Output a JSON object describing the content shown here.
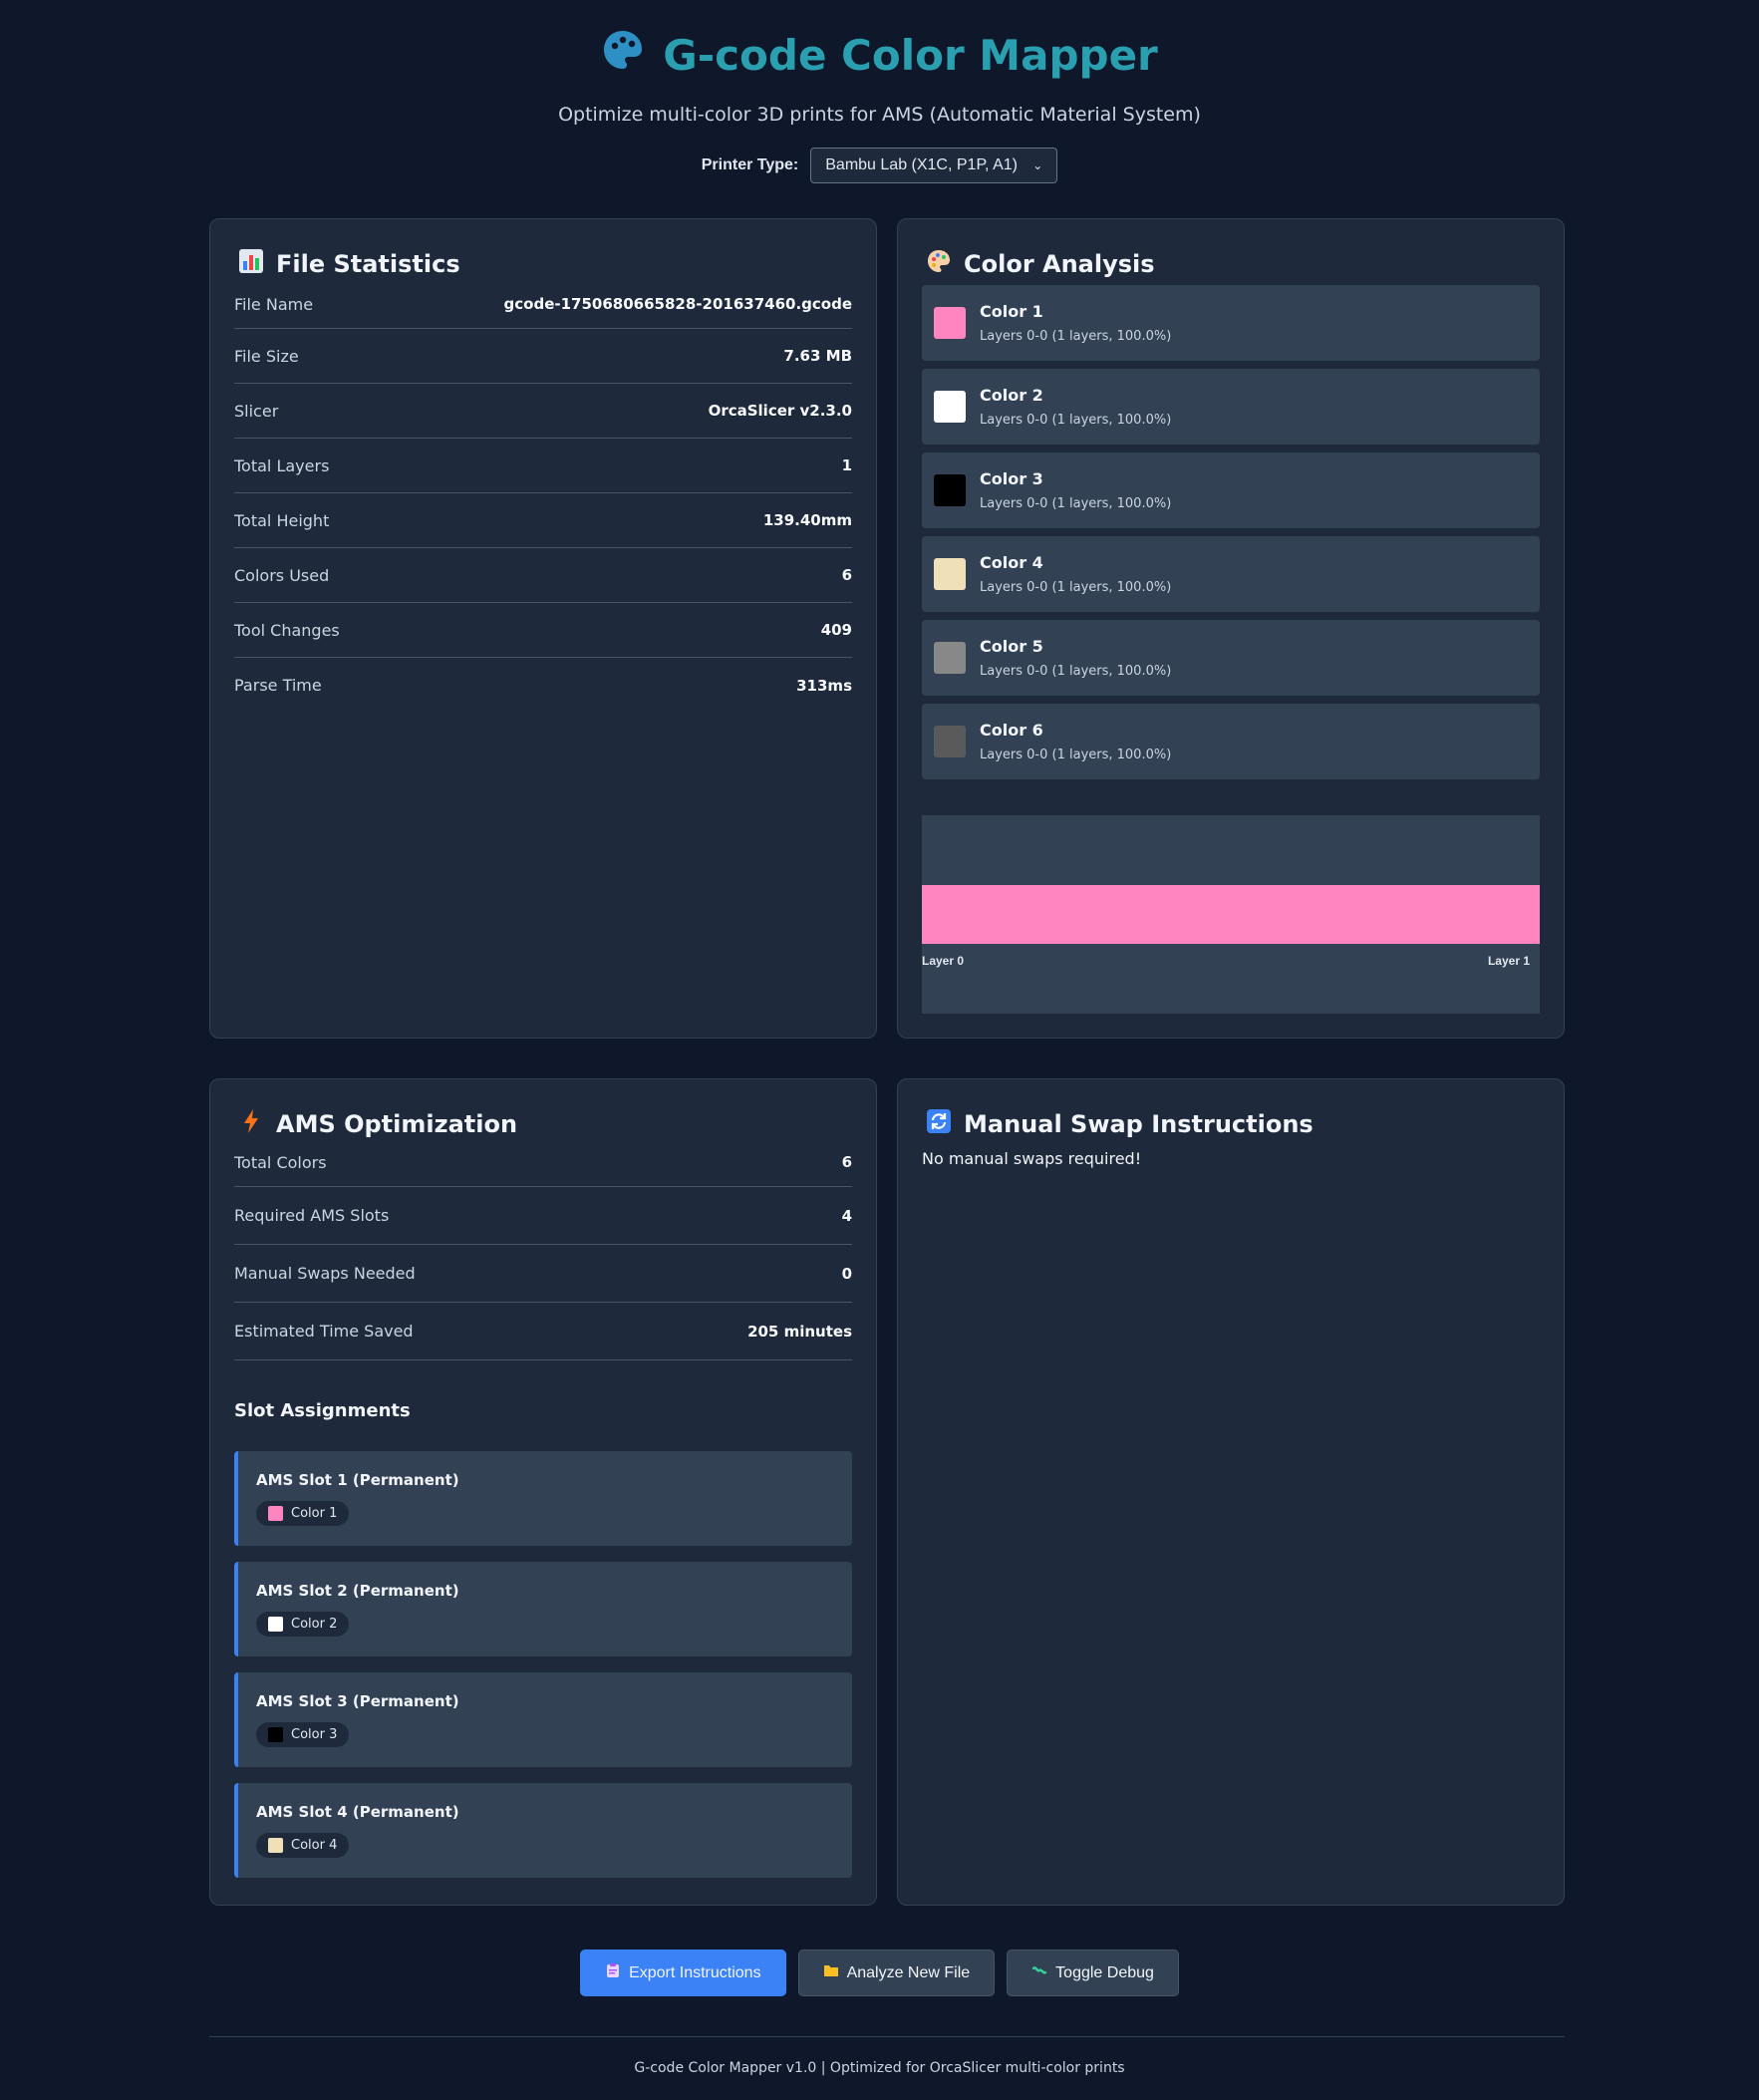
{
  "header": {
    "title": "G-code Color Mapper",
    "subtitle": "Optimize multi-color 3D prints for AMS (Automatic Material System)",
    "printer_label": "Printer Type:",
    "printer_value": "Bambu Lab (X1C, P1P, A1)"
  },
  "file_stats": {
    "title": "File Statistics",
    "icon": "bar-chart-icon",
    "rows": [
      {
        "label": "File Name",
        "value": "gcode-1750680665828-201637460.gcode"
      },
      {
        "label": "File Size",
        "value": "7.63 MB"
      },
      {
        "label": "Slicer",
        "value": "OrcaSlicer v2.3.0"
      },
      {
        "label": "Total Layers",
        "value": "1"
      },
      {
        "label": "Total Height",
        "value": "139.40mm"
      },
      {
        "label": "Colors Used",
        "value": "6"
      },
      {
        "label": "Tool Changes",
        "value": "409"
      },
      {
        "label": "Parse Time",
        "value": "313ms"
      }
    ]
  },
  "color_analysis": {
    "title": "Color Analysis",
    "icon": "palette-icon",
    "colors": [
      {
        "name": "Color 1",
        "info": "Layers 0-0 (1 layers, 100.0%)",
        "hex": "#ff85c0"
      },
      {
        "name": "Color 2",
        "info": "Layers 0-0 (1 layers, 100.0%)",
        "hex": "#ffffff"
      },
      {
        "name": "Color 3",
        "info": "Layers 0-0 (1 layers, 100.0%)",
        "hex": "#000000"
      },
      {
        "name": "Color 4",
        "info": "Layers 0-0 (1 layers, 100.0%)",
        "hex": "#f0e0b8"
      },
      {
        "name": "Color 5",
        "info": "Layers 0-0 (1 layers, 100.0%)",
        "hex": "#888888"
      },
      {
        "name": "Color 6",
        "info": "Layers 0-0 (1 layers, 100.0%)",
        "hex": "#5a5a5a"
      }
    ],
    "timeline": {
      "start_label": "Layer 0",
      "end_label": "Layer 1",
      "bar_color": "#ff85c0"
    }
  },
  "ams": {
    "title": "AMS Optimization",
    "icon": "lightning-icon",
    "rows": [
      {
        "label": "Total Colors",
        "value": "6"
      },
      {
        "label": "Required AMS Slots",
        "value": "4"
      },
      {
        "label": "Manual Swaps Needed",
        "value": "0"
      },
      {
        "label": "Estimated Time Saved",
        "value": "205 minutes"
      }
    ],
    "slot_heading": "Slot Assignments",
    "slots": [
      {
        "title": "AMS Slot 1 (Permanent)",
        "color": "Color 1",
        "hex": "#ff85c0"
      },
      {
        "title": "AMS Slot 2 (Permanent)",
        "color": "Color 2",
        "hex": "#ffffff"
      },
      {
        "title": "AMS Slot 3 (Permanent)",
        "color": "Color 3",
        "hex": "#000000"
      },
      {
        "title": "AMS Slot 4 (Permanent)",
        "color": "Color 4",
        "hex": "#f0e0b8"
      }
    ]
  },
  "manual_swaps": {
    "title": "Manual Swap Instructions",
    "icon": "refresh-icon",
    "message": "No manual swaps required!"
  },
  "actions": {
    "export": "Export Instructions",
    "analyze": "Analyze New File",
    "debug": "Toggle Debug"
  },
  "footer": "G-code Color Mapper v1.0 | Optimized for OrcaSlicer multi-color prints",
  "theme": {
    "accent": "#2a9fb0",
    "primary_button": "#3b82f6",
    "background": "#0f172a",
    "card": "#1e293b"
  }
}
